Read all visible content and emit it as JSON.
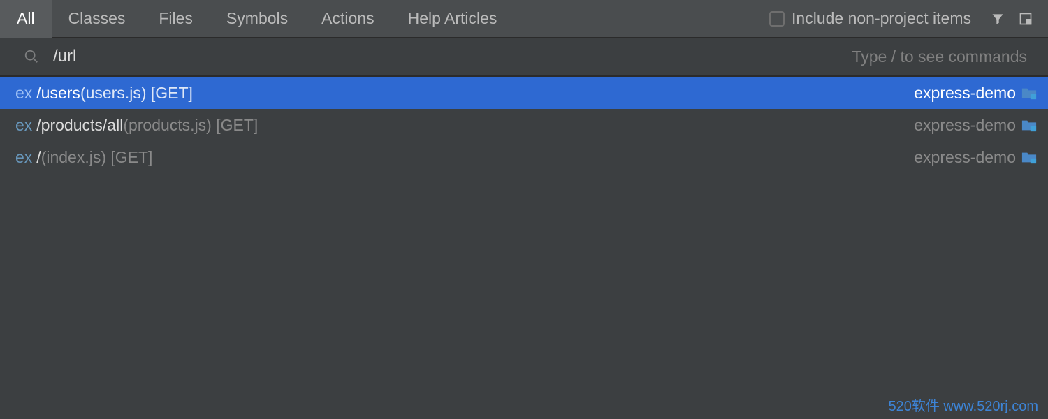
{
  "tabs": [
    "All",
    "Classes",
    "Files",
    "Symbols",
    "Actions",
    "Help Articles"
  ],
  "active_tab": 0,
  "include_nonproject_label": "Include non-project items",
  "search": {
    "value": "/url",
    "hint": "Type / to see commands"
  },
  "results": [
    {
      "prefix": "ex",
      "primary": "/users",
      "detail": " (users.js) [GET]",
      "module": "express-demo",
      "selected": true
    },
    {
      "prefix": "ex",
      "primary": "/products/all",
      "detail": " (products.js) [GET]",
      "module": "express-demo",
      "selected": false
    },
    {
      "prefix": "ex",
      "primary": "/",
      "detail": " (index.js) [GET]",
      "module": "express-demo",
      "selected": false
    }
  ],
  "watermark": "520软件 www.520rj.com"
}
